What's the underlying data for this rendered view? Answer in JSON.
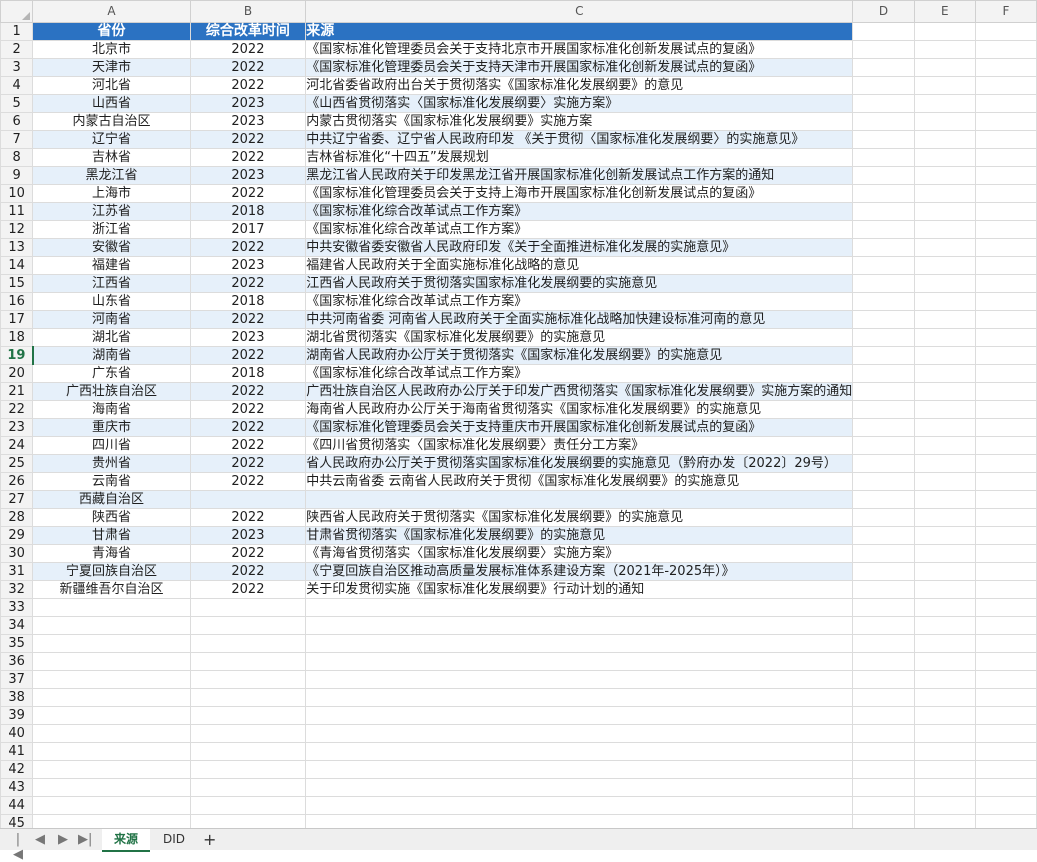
{
  "columns": [
    "A",
    "B",
    "C",
    "D",
    "E",
    "F"
  ],
  "header": {
    "province": "省份",
    "reform_time": "综合改革时间",
    "source": "来源"
  },
  "rows": [
    {
      "province": "北京市",
      "year": "2022",
      "source": "《国家标准化管理委员会关于支持北京市开展国家标准化创新发展试点的复函》"
    },
    {
      "province": "天津市",
      "year": "2022",
      "source": "《国家标准化管理委员会关于支持天津市开展国家标准化创新发展试点的复函》"
    },
    {
      "province": "河北省",
      "year": "2022",
      "source": "河北省委省政府出台关于贯彻落实《国家标准化发展纲要》的意见"
    },
    {
      "province": "山西省",
      "year": "2023",
      "source": "《山西省贯彻落实〈国家标准化发展纲要〉实施方案》"
    },
    {
      "province": "内蒙古自治区",
      "year": "2023",
      "source": "内蒙古贯彻落实《国家标准化发展纲要》实施方案"
    },
    {
      "province": "辽宁省",
      "year": "2022",
      "source": "中共辽宁省委、辽宁省人民政府印发 《关于贯彻〈国家标准化发展纲要〉的实施意见》"
    },
    {
      "province": "吉林省",
      "year": "2022",
      "source": "吉林省标准化“十四五”发展规划"
    },
    {
      "province": "黑龙江省",
      "year": "2023",
      "source": "黑龙江省人民政府关于印发黑龙江省开展国家标准化创新发展试点工作方案的通知"
    },
    {
      "province": "上海市",
      "year": "2022",
      "source": "《国家标准化管理委员会关于支持上海市开展国家标准化创新发展试点的复函》"
    },
    {
      "province": "江苏省",
      "year": "2018",
      "source": "《国家标准化综合改革试点工作方案》"
    },
    {
      "province": "浙江省",
      "year": "2017",
      "source": "《国家标准化综合改革试点工作方案》"
    },
    {
      "province": "安徽省",
      "year": "2022",
      "source": "中共安徽省委安徽省人民政府印发《关于全面推进标准化发展的实施意见》"
    },
    {
      "province": "福建省",
      "year": "2023",
      "source": "福建省人民政府关于全面实施标准化战略的意见"
    },
    {
      "province": "江西省",
      "year": "2022",
      "source": "江西省人民政府关于贯彻落实国家标准化发展纲要的实施意见"
    },
    {
      "province": "山东省",
      "year": "2018",
      "source": "《国家标准化综合改革试点工作方案》"
    },
    {
      "province": "河南省",
      "year": "2022",
      "source": "中共河南省委  河南省人民政府关于全面实施标准化战略加快建设标准河南的意见"
    },
    {
      "province": "湖北省",
      "year": "2023",
      "source": "湖北省贯彻落实《国家标准化发展纲要》的实施意见"
    },
    {
      "province": "湖南省",
      "year": "2022",
      "source": "湖南省人民政府办公厅关于贯彻落实《国家标准化发展纲要》的实施意见"
    },
    {
      "province": "广东省",
      "year": "2018",
      "source": "《国家标准化综合改革试点工作方案》"
    },
    {
      "province": "广西壮族自治区",
      "year": "2022",
      "source": "广西壮族自治区人民政府办公厅关于印发广西贯彻落实《国家标准化发展纲要》实施方案的通知"
    },
    {
      "province": "海南省",
      "year": "2022",
      "source": "海南省人民政府办公厅关于海南省贯彻落实《国家标准化发展纲要》的实施意见"
    },
    {
      "province": "重庆市",
      "year": "2022",
      "source": "《国家标准化管理委员会关于支持重庆市开展国家标准化创新发展试点的复函》"
    },
    {
      "province": "四川省",
      "year": "2022",
      "source": "《四川省贯彻落实〈国家标准化发展纲要〉责任分工方案》"
    },
    {
      "province": "贵州省",
      "year": "2022",
      "source": "省人民政府办公厅关于贯彻落实国家标准化发展纲要的实施意见（黔府办发〔2022〕29号）"
    },
    {
      "province": "云南省",
      "year": "2022",
      "source": "中共云南省委  云南省人民政府关于贯彻《国家标准化发展纲要》的实施意见"
    },
    {
      "province": "西藏自治区",
      "year": "",
      "source": ""
    },
    {
      "province": "陕西省",
      "year": "2022",
      "source": "陕西省人民政府关于贯彻落实《国家标准化发展纲要》的实施意见"
    },
    {
      "province": "甘肃省",
      "year": "2023",
      "source": "甘肃省贯彻落实《国家标准化发展纲要》的实施意见"
    },
    {
      "province": "青海省",
      "year": "2022",
      "source": "《青海省贯彻落实〈国家标准化发展纲要〉实施方案》"
    },
    {
      "province": "宁夏回族自治区",
      "year": "2022",
      "source": "《宁夏回族自治区推动高质量发展标准体系建设方案（2021年-2025年）》"
    },
    {
      "province": "新疆维吾尔自治区",
      "year": "2022",
      "source": "关于印发贯彻实施《国家标准化发展纲要》行动计划的通知"
    }
  ],
  "total_rows": 45,
  "active_row": 19,
  "sheet_tabs": [
    "来源",
    "DID"
  ],
  "active_tab": "来源",
  "colors": {
    "header_bg": "#2b72c2",
    "band_bg": "#e6f0fa",
    "accent": "#217346"
  },
  "icons": {
    "first": "|◀",
    "prev": "◀",
    "next": "▶",
    "last": "▶|",
    "add": "+"
  }
}
